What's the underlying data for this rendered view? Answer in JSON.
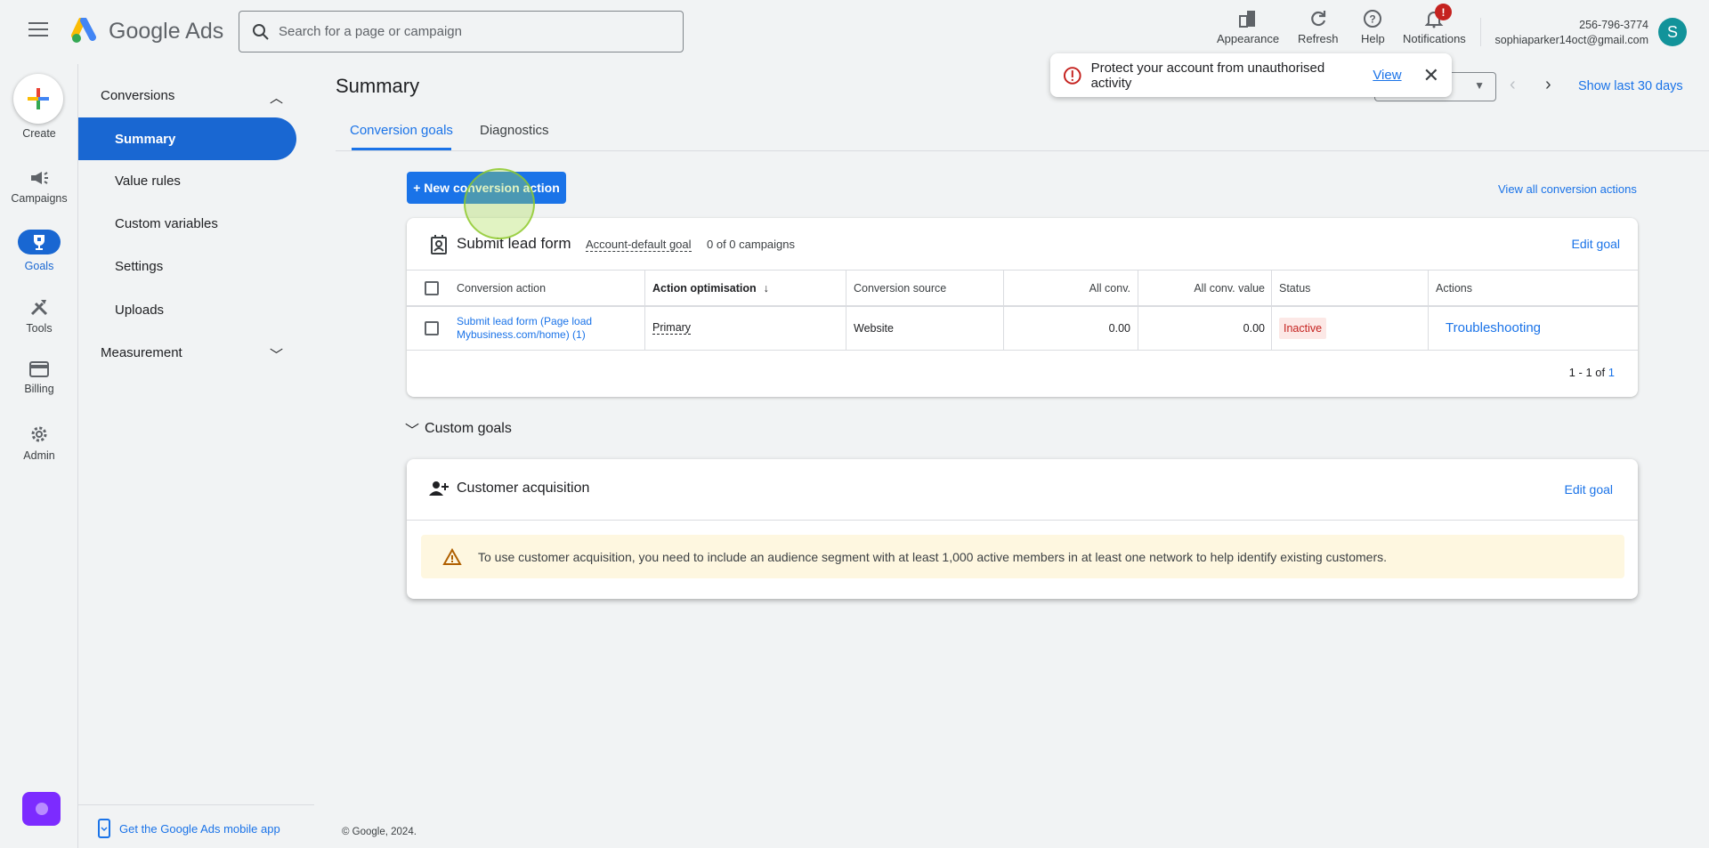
{
  "header": {
    "app_name": "Google Ads",
    "search_placeholder": "Search for a page or campaign",
    "tools": [
      {
        "label": "Appearance",
        "icon": "appearance-icon"
      },
      {
        "label": "Refresh",
        "icon": "refresh-icon"
      },
      {
        "label": "Help",
        "icon": "help-icon"
      },
      {
        "label": "Notifications",
        "icon": "bell-icon"
      }
    ],
    "notification_badge": "!",
    "phone": "256-796-3774",
    "email": "sophiaparker14oct@gmail.com",
    "avatar_letter": "S"
  },
  "rail": {
    "create": "Create",
    "items": [
      {
        "label": "Campaigns"
      },
      {
        "label": "Goals"
      },
      {
        "label": "Tools"
      },
      {
        "label": "Billing"
      },
      {
        "label": "Admin"
      }
    ]
  },
  "nav": {
    "section1": "Conversions",
    "items": [
      "Summary",
      "Value rules",
      "Custom variables",
      "Settings",
      "Uploads"
    ],
    "section2": "Measurement",
    "footer": "Get the Google Ads mobile app"
  },
  "page": {
    "title": "Summary",
    "tabs": [
      "Conversion goals",
      "Diagnostics"
    ],
    "new_button": "+ New conversion action",
    "view_all": "View all conversion actions",
    "show_last": "Show last 30 days",
    "footer": "© Google, 2024."
  },
  "toast": {
    "text": "Protect your account from unauthorised activity",
    "link": "View"
  },
  "goal_card": {
    "title": "Submit lead form",
    "default_label": "Account-default goal",
    "campaigns": "0 of 0 campaigns",
    "edit": "Edit goal",
    "columns": [
      "Conversion action",
      "Action optimisation",
      "Conversion source",
      "All conv.",
      "All conv. value",
      "Status",
      "Actions"
    ],
    "row": {
      "action_line1": "Submit lead form (Page load",
      "action_line2": "Mybusiness.com/home) (1)",
      "optimisation": "Primary",
      "source": "Website",
      "all_conv": "0.00",
      "all_conv_value": "0.00",
      "status": "Inactive",
      "actions": "Troubleshooting"
    },
    "pagination": {
      "range": "1 - 1 of",
      "total": "1"
    }
  },
  "custom_goals": {
    "label": "Custom goals",
    "card_title": "Customer acquisition",
    "edit": "Edit goal",
    "warning": "To use customer acquisition, you need to include an audience segment with at least 1,000 active members in at least one network to help identify existing customers."
  },
  "colors": {
    "accent": "#1a73e8",
    "nav_selected": "#1967d2",
    "inactive_bg": "#fce8e6",
    "inactive_text": "#c5221f",
    "warning_bg": "#fef7e0"
  }
}
